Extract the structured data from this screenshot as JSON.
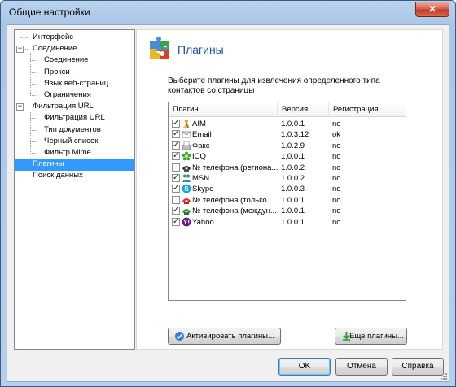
{
  "window": {
    "title": "Общие настройки",
    "close_glyph": "✕"
  },
  "tree": {
    "items": [
      {
        "label": "Интерфейс",
        "level": 0,
        "expander": ""
      },
      {
        "label": "Соединение",
        "level": 0,
        "expander": "−"
      },
      {
        "label": "Соединение",
        "level": 1,
        "expander": ""
      },
      {
        "label": "Прокси",
        "level": 1,
        "expander": ""
      },
      {
        "label": "Язык веб-страниц",
        "level": 1,
        "expander": ""
      },
      {
        "label": "Ограничения",
        "level": 1,
        "expander": ""
      },
      {
        "label": "Фильтрация URL",
        "level": 0,
        "expander": "−"
      },
      {
        "label": "Фильтрация URL",
        "level": 1,
        "expander": ""
      },
      {
        "label": "Тип документов",
        "level": 1,
        "expander": ""
      },
      {
        "label": "Черный список",
        "level": 1,
        "expander": ""
      },
      {
        "label": "Фильтр Mime",
        "level": 1,
        "expander": ""
      },
      {
        "label": "Плагины",
        "level": 0,
        "expander": "",
        "selected": true
      },
      {
        "label": "Поиск данных",
        "level": 0,
        "expander": ""
      }
    ]
  },
  "panel": {
    "title": "Плагины",
    "icon": "puzzle-icon",
    "description": "Выберите плагины для извлечения определенного типа контактов со страницы"
  },
  "plugins_table": {
    "columns": [
      "Плагин",
      "Версия",
      "Регистрация"
    ],
    "check_glyph": "✓",
    "rows": [
      {
        "checked": true,
        "icon": "aim-icon",
        "name": "AIM",
        "version": "1.0.0.1",
        "registration": "no"
      },
      {
        "checked": true,
        "icon": "email-icon",
        "name": "Email",
        "version": "1.0.3.12",
        "registration": "ok"
      },
      {
        "checked": true,
        "icon": "fax-icon",
        "name": "Факс",
        "version": "1.0.2.9",
        "registration": "no"
      },
      {
        "checked": true,
        "icon": "icq-icon",
        "name": "ICQ",
        "version": "1.0.0.1",
        "registration": "no"
      },
      {
        "checked": false,
        "icon": "phone-icon",
        "name": "№ телефона (регионa...",
        "version": "1.0.0.2",
        "registration": "no"
      },
      {
        "checked": true,
        "icon": "msn-icon",
        "name": "MSN",
        "version": "1.0.0.2",
        "registration": "no"
      },
      {
        "checked": true,
        "icon": "skype-icon",
        "name": "Skype",
        "version": "1.0.0.3",
        "registration": "no"
      },
      {
        "checked": false,
        "icon": "phone-red-icon",
        "name": "№ телефона (только ...",
        "version": "1.0.0.1",
        "registration": "no"
      },
      {
        "checked": true,
        "icon": "phone-green-icon",
        "name": "№ телефона (междун...",
        "version": "1.0.0.1",
        "registration": "no"
      },
      {
        "checked": true,
        "icon": "yahoo-icon",
        "name": "Yahoo",
        "version": "1.0.0.1",
        "registration": "no"
      }
    ]
  },
  "buttons": {
    "activate": "Активировать плагины...",
    "more": "Еще плагины...",
    "ok": "OK",
    "cancel": "Отмена",
    "help": "Справка"
  },
  "colors": {
    "accent": "#1e50a2",
    "selection": "#3399ff",
    "close_button": "#c43c22"
  }
}
